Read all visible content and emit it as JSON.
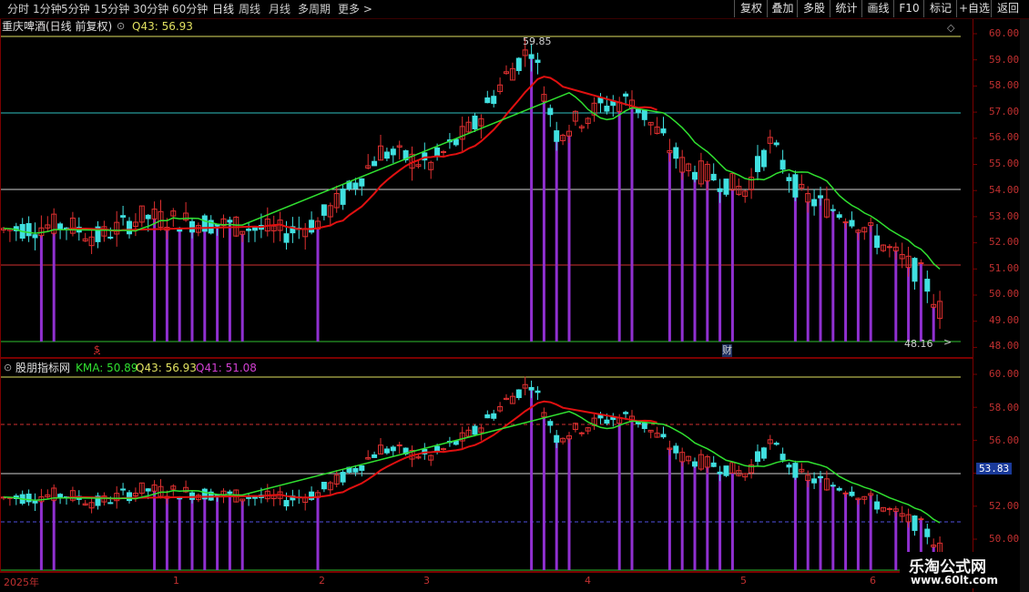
{
  "toolbar": {
    "periods": [
      "分时",
      "1分钟",
      "5分钟",
      "15分钟",
      "30分钟",
      "60分钟",
      "日线",
      "周线",
      "月线",
      "多周期",
      "更多 >"
    ],
    "active_period": "日线",
    "buttons": [
      "复权",
      "叠加",
      "多股",
      "统计",
      "画线",
      "F10",
      "标记",
      "+自选",
      "返回"
    ]
  },
  "main_panel": {
    "stock_title": "重庆啤酒(日线 前复权)",
    "indicator_text": "Q43: 56.93",
    "high_label": "59.85",
    "low_label": "48.16",
    "marker_dollar": "$",
    "marker_cai": "财",
    "price_ticks": [
      "60.00",
      "59.00",
      "58.00",
      "57.00",
      "56.00",
      "55.00",
      "54.00",
      "53.00",
      "52.00",
      "51.00",
      "50.00",
      "49.00",
      "48.00"
    ]
  },
  "sub_panel": {
    "indicator_name": "股朋指标网",
    "kma_text": "KMA: 50.89",
    "q43_text": "Q43: 56.93",
    "q41_text": "Q41: 51.08",
    "price_ticks": [
      "60.00",
      "58.00",
      "56.00",
      "54.00",
      "52.00",
      "50.00"
    ],
    "current_value": "53.83"
  },
  "date_axis": {
    "labels": [
      "2025年",
      "1",
      "2",
      "3",
      "4",
      "5",
      "6"
    ]
  },
  "watermark": {
    "line1": "乐淘公式网",
    "line2": "www.60lt.com"
  },
  "colors": {
    "up": "#e03030",
    "down": "#40e0e0",
    "ma_red": "#e01010",
    "ma_green": "#30e030",
    "purple": "#9030d0",
    "yellow_line": "#e0e060",
    "cyan_line": "#30c0c0",
    "white_line": "#d0d0d0",
    "red_line": "#d03030",
    "green_line": "#30c030"
  }
}
